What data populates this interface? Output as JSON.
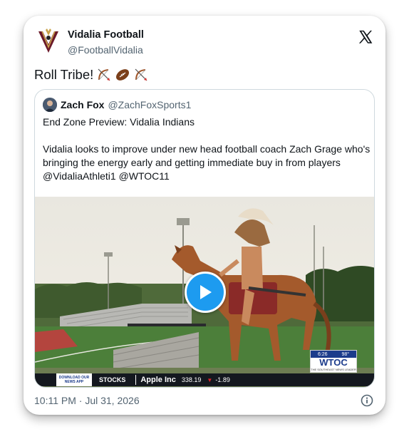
{
  "author": {
    "display_name": "Vidalia Football",
    "handle": "@FootballVidalia"
  },
  "tweet": {
    "text": "Roll Tribe!",
    "emoji": [
      "bow-and-arrow",
      "football",
      "bow-and-arrow"
    ]
  },
  "quoted": {
    "display_name": "Zach Fox",
    "handle": "@ZachFoxSports1",
    "lines": [
      "End Zone Preview: Vidalia Indians",
      "",
      "Vidalia looks to improve under new head football coach Zach Grage who's",
      "bringing the energy early and getting immediate buy in from players",
      "@VidaliaAthleti1 @WTOC11"
    ]
  },
  "video": {
    "ticker": {
      "app_label": "DOWNLOAD OUR NEWS APP",
      "section": "STOCKS",
      "company": "Apple Inc",
      "price": "338.19",
      "change": "-1.89"
    },
    "bug": {
      "time": "6:26",
      "temp": "98°",
      "station": "WTOC",
      "tagline": "THE SOUTHEAST NEWS LEADER"
    }
  },
  "footer": {
    "timestamp": "10:11 PM · Jul 31, 2026"
  },
  "colors": {
    "accent": "#1d9bf0",
    "text": "#0f1419",
    "muted": "#536471",
    "border": "#cfd9de"
  },
  "icons": {
    "platform": "x-logo-icon",
    "info": "info-icon",
    "play": "play-icon"
  }
}
